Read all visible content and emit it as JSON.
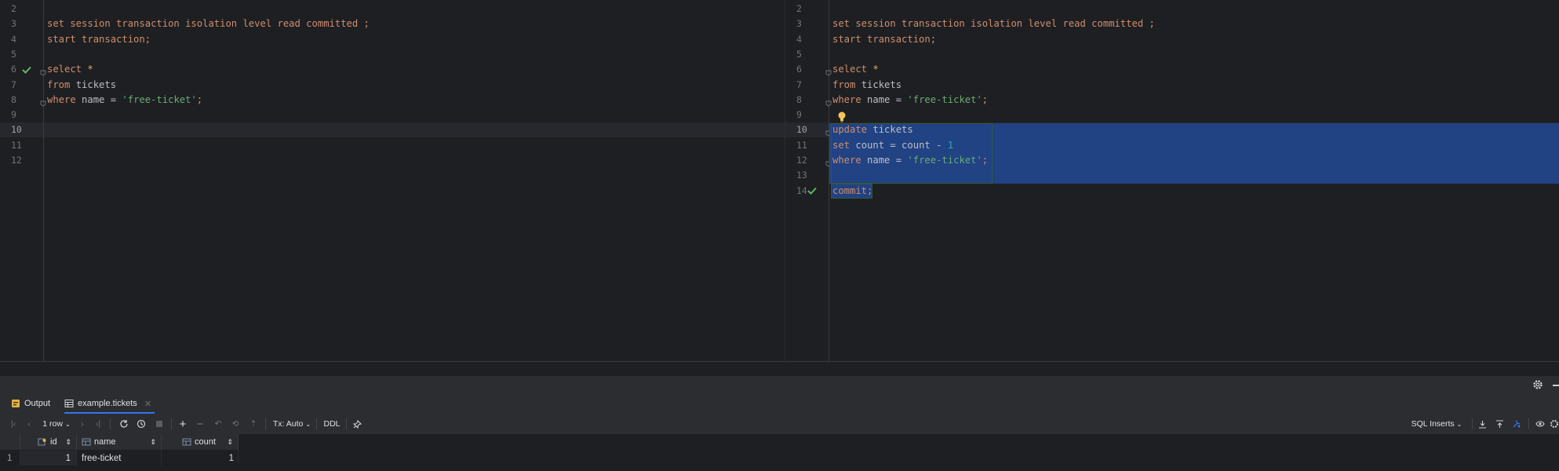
{
  "left_editor": {
    "lines": [
      {
        "n": "2",
        "tokens": []
      },
      {
        "n": "3",
        "tokens": [
          {
            "t": "set session transaction isolation level read committed ;",
            "c": "kw"
          }
        ]
      },
      {
        "n": "4",
        "tokens": [
          {
            "t": "start transaction;",
            "c": "kw"
          }
        ]
      },
      {
        "n": "5",
        "tokens": []
      },
      {
        "n": "6",
        "tokens": [
          {
            "t": "select ",
            "c": "kw"
          },
          {
            "t": "*",
            "c": "star"
          }
        ],
        "check": true,
        "fold": true
      },
      {
        "n": "7",
        "tokens": [
          {
            "t": "from ",
            "c": "kw"
          },
          {
            "t": "tickets",
            "c": "id"
          }
        ]
      },
      {
        "n": "8",
        "tokens": [
          {
            "t": "where ",
            "c": "kw"
          },
          {
            "t": "name = ",
            "c": "id"
          },
          {
            "t": "'free-ticket'",
            "c": "str"
          },
          {
            "t": ";",
            "c": "kw"
          }
        ],
        "fold": true
      },
      {
        "n": "9",
        "tokens": []
      },
      {
        "n": "10",
        "tokens": [],
        "current": true
      },
      {
        "n": "11",
        "tokens": []
      },
      {
        "n": "12",
        "tokens": []
      }
    ]
  },
  "right_editor": {
    "lines": [
      {
        "n": "2",
        "tokens": []
      },
      {
        "n": "3",
        "tokens": [
          {
            "t": "set session transaction isolation level read committed ;",
            "c": "kw"
          }
        ]
      },
      {
        "n": "4",
        "tokens": [
          {
            "t": "start transaction;",
            "c": "kw"
          }
        ]
      },
      {
        "n": "5",
        "tokens": []
      },
      {
        "n": "6",
        "tokens": [
          {
            "t": "select ",
            "c": "kw"
          },
          {
            "t": "*",
            "c": "star"
          }
        ],
        "fold": true
      },
      {
        "n": "7",
        "tokens": [
          {
            "t": "from ",
            "c": "kw"
          },
          {
            "t": "tickets",
            "c": "id"
          }
        ]
      },
      {
        "n": "8",
        "tokens": [
          {
            "t": "where ",
            "c": "kw"
          },
          {
            "t": "name = ",
            "c": "id"
          },
          {
            "t": "'free-ticket'",
            "c": "str"
          },
          {
            "t": ";",
            "c": "kw"
          }
        ],
        "fold": true
      },
      {
        "n": "9",
        "tokens": []
      },
      {
        "n": "10",
        "tokens": [
          {
            "t": "update ",
            "c": "kw"
          },
          {
            "t": "tickets",
            "c": "id"
          }
        ],
        "current": true,
        "fold": true
      },
      {
        "n": "11",
        "tokens": [
          {
            "t": "set ",
            "c": "kw"
          },
          {
            "t": "count = count - ",
            "c": "id"
          },
          {
            "t": "1",
            "c": "num"
          }
        ]
      },
      {
        "n": "12",
        "tokens": [
          {
            "t": "where ",
            "c": "kw"
          },
          {
            "t": "name = ",
            "c": "id"
          },
          {
            "t": "'free-ticket'",
            "c": "str"
          },
          {
            "t": ";",
            "c": "kw"
          }
        ],
        "fold": true
      },
      {
        "n": "13",
        "tokens": []
      },
      {
        "n": "14",
        "tokens": [
          {
            "t": "commit;",
            "c": "kw"
          }
        ],
        "check": true
      }
    ]
  },
  "tool_window": {
    "tabs": [
      {
        "label": "Output",
        "icon": "output-icon",
        "active": false
      },
      {
        "label": "example.tickets",
        "icon": "table-icon",
        "active": true,
        "closable": true
      }
    ],
    "toolbar": {
      "row_count": "1 row",
      "tx_mode": "Tx: Auto",
      "ddl_label": "DDL",
      "export_format": "SQL Inserts"
    },
    "grid": {
      "columns": [
        {
          "label": "id",
          "icon": "key-column-icon"
        },
        {
          "label": "name",
          "icon": "column-icon"
        },
        {
          "label": "count",
          "icon": "column-icon"
        }
      ],
      "rows": [
        {
          "row_num": "1",
          "cells": [
            "1",
            "free-ticket",
            "1"
          ]
        }
      ]
    }
  },
  "colors": {
    "editor_bg": "#1e1f22",
    "panel_bg": "#2b2d30",
    "keyword": "#cf8e6d",
    "string": "#6aab73",
    "number": "#2aacb8",
    "selection": "#214283",
    "check": "#5fb865",
    "accent": "#3574f0"
  }
}
